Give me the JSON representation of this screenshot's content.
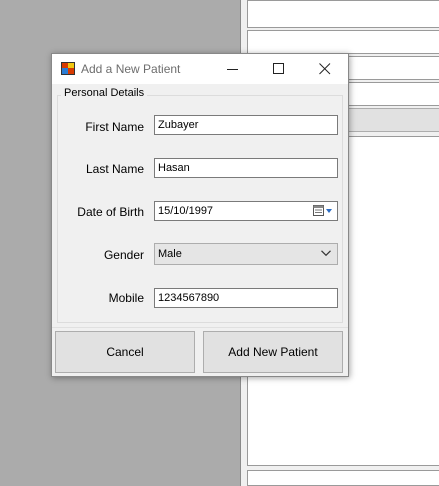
{
  "dialog": {
    "title": "Add a New Patient",
    "group_title": "Personal Details",
    "fields": {
      "first_name": {
        "label": "First Name",
        "value": "Zubayer"
      },
      "last_name": {
        "label": "Last Name",
        "value": "Hasan"
      },
      "date_of_birth": {
        "label": "Date of Birth",
        "value": "15/10/1997"
      },
      "gender": {
        "label": "Gender",
        "value": "Male"
      },
      "mobile": {
        "label": "Mobile",
        "value": "1234567890"
      }
    },
    "buttons": {
      "cancel": "Cancel",
      "add": "Add New Patient"
    }
  },
  "icons": {
    "app": "app-icon",
    "minimize": "minimize-icon",
    "maximize": "maximize-icon",
    "close": "close-icon",
    "calendar": "calendar-icon",
    "dropdown": "chevron-down-icon"
  }
}
